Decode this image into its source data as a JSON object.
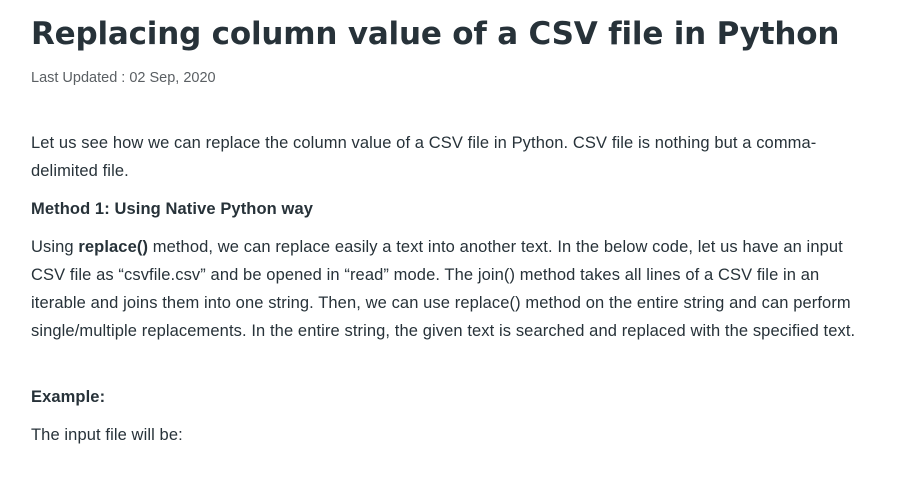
{
  "article": {
    "title": "Replacing column value of a CSV file in Python",
    "last_updated": "Last Updated : 02 Sep, 2020",
    "intro": "Let us see how we can replace the column value of a CSV file in Python. CSV file is nothing but a comma-delimited file.",
    "method_heading": "Method 1: Using Native Python way",
    "method_desc_prefix": "Using ",
    "method_desc_code": "replace()",
    "method_desc_rest": " method, we can replace easily a text into another text.  In the below code, let us have an input CSV file as “csvfile.csv” and be opened in “read” mode. The join() method takes all lines of a CSV file in an iterable and joins them into one string. Then, we can use replace() method on the entire string and can perform single/multiple replacements. In the entire string, the given text is searched and replaced with the specified text.",
    "example_heading": "Example:",
    "input_note": "The input file will be:"
  }
}
